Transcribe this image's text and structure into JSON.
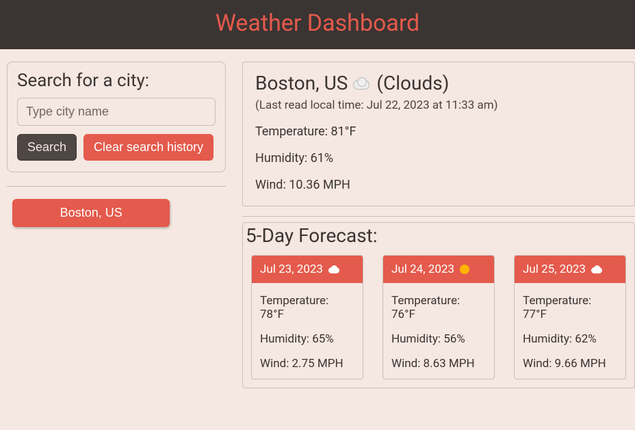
{
  "header": {
    "title": "Weather Dashboard"
  },
  "search": {
    "title": "Search for a city:",
    "placeholder": "Type city name",
    "search_label": "Search",
    "clear_label": "Clear search history"
  },
  "history": [
    {
      "label": "Boston, US"
    }
  ],
  "current": {
    "city": "Boston, US",
    "condition_label": "(Clouds)",
    "icon": "cloud",
    "last_read": "(Last read local time: Jul 22, 2023 at 11:33 am)",
    "temperature": "Temperature: 81°F",
    "humidity": "Humidity: 61%",
    "wind": "Wind: 10.36 MPH"
  },
  "forecast": {
    "title": "5-Day Forecast:",
    "days": [
      {
        "date": "Jul 23, 2023",
        "icon": "cloud",
        "temperature": "Temperature: 78°F",
        "humidity": "Humidity: 65%",
        "wind": "Wind: 2.75 MPH"
      },
      {
        "date": "Jul 24, 2023",
        "icon": "sun",
        "temperature": "Temperature: 76°F",
        "humidity": "Humidity: 56%",
        "wind": "Wind: 8.63 MPH"
      },
      {
        "date": "Jul 25, 2023",
        "icon": "cloud",
        "temperature": "Temperature: 77°F",
        "humidity": "Humidity: 62%",
        "wind": "Wind: 9.66 MPH"
      }
    ]
  }
}
